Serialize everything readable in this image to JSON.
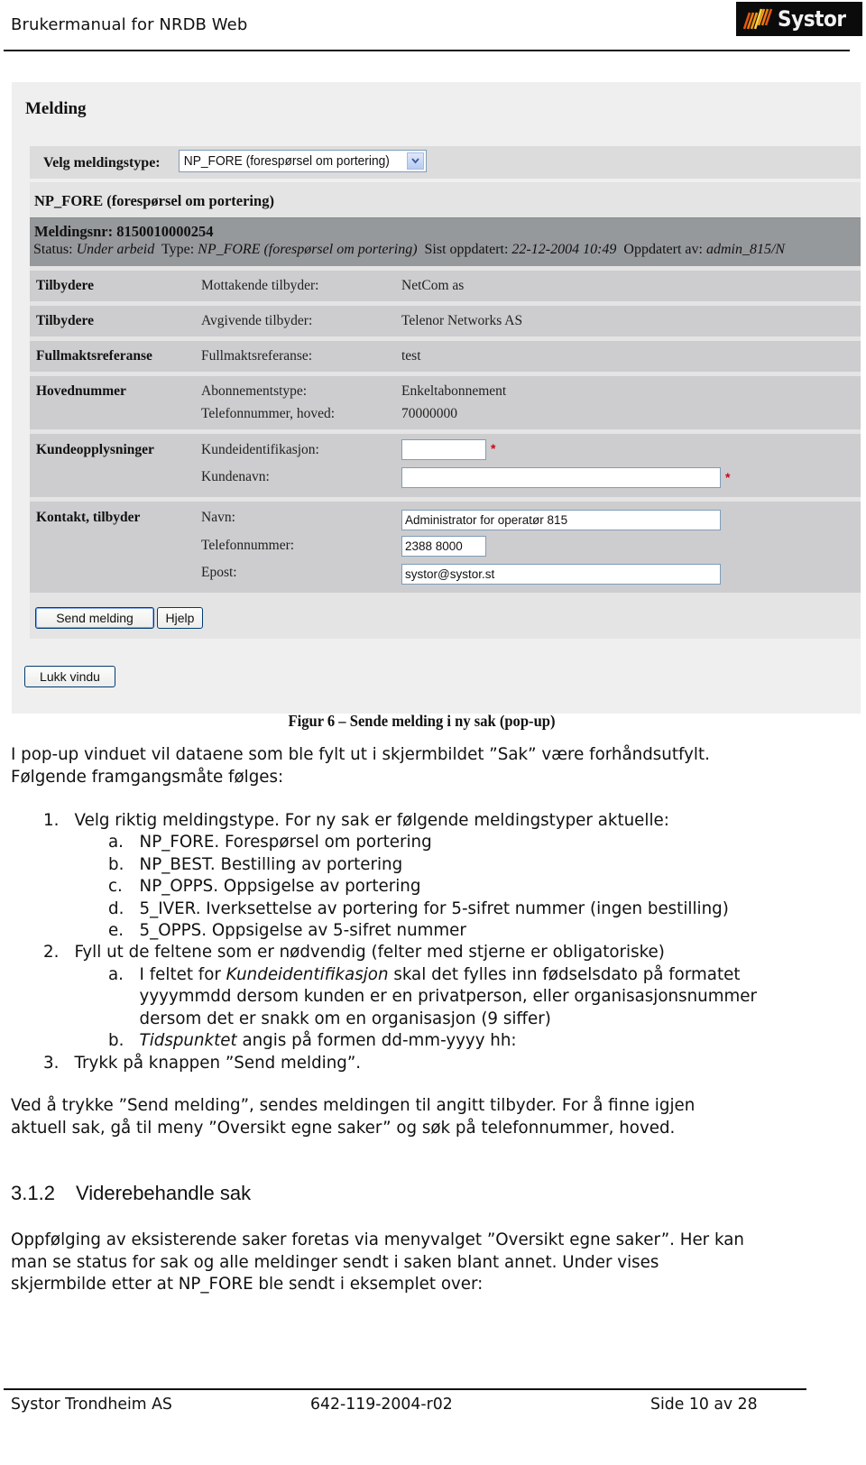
{
  "header": {
    "title": "Brukermanual for NRDB Web",
    "logo_text": "Systor",
    "logo_icon": "systor-stripes-logo"
  },
  "screenshot": {
    "title": "Melding",
    "type_label": "Velg meldingstype:",
    "type_selected": "NP_FORE (forespørsel om portering)",
    "panel_title": "NP_FORE (forespørsel om portering)",
    "meta": {
      "meldingsnr_label": "Meldingsnr:",
      "meldingsnr": "8150010000254",
      "status_label": "Status:",
      "status": "Under arbeid",
      "type_label": "Type:",
      "type": "NP_FORE (forespørsel om portering)",
      "updated_label": "Sist oppdatert:",
      "updated": "22-12-2004 10:49",
      "updated_by_label": "Oppdatert av:",
      "updated_by": "admin_815/N"
    },
    "rows": [
      {
        "section": "Tilbydere",
        "label": "Mottakende tilbyder:",
        "value": "NetCom as"
      },
      {
        "section": "Tilbydere",
        "label": "Avgivende tilbyder:",
        "value": "Telenor Networks AS"
      },
      {
        "section": "Fullmaktsreferanse",
        "label": "Fullmaktsreferanse:",
        "value": "test"
      },
      {
        "section": "Hovednummer",
        "label": "Abonnementstype:",
        "value": "Enkeltabonnement",
        "label2": "Telefonnummer, hoved:",
        "value2": "70000000"
      }
    ],
    "customer": {
      "section": "Kundeopplysninger",
      "id_label": "Kundeidentifikasjon:",
      "id_value": "",
      "name_label": "Kundenavn:",
      "name_value": "",
      "required_mark": "*"
    },
    "contact": {
      "section": "Kontakt, tilbyder",
      "name_label": "Navn:",
      "name_value": "Administrator for operatør 815",
      "phone_label": "Telefonnummer:",
      "phone_value": "2388 8000",
      "email_label": "Epost:",
      "email_value": "systor@systor.st"
    },
    "buttons": {
      "send": "Send melding",
      "help": "Hjelp",
      "close": "Lukk vindu"
    }
  },
  "caption": "Figur 6 – Sende melding i ny sak (pop-up)",
  "intro": [
    "I pop-up vinduet vil dataene som ble fylt ut i skjermbildet ”Sak” være forhåndsutfylt.",
    "Følgende framgangsmåte følges:"
  ],
  "steps": [
    {
      "marker": "1.",
      "text": "Velg riktig meldingstype. For ny sak er følgende meldingstyper aktuelle:",
      "sub": [
        {
          "marker": "a.",
          "text": "NP_FORE. Forespørsel om portering"
        },
        {
          "marker": "b.",
          "text": "NP_BEST. Bestilling av portering"
        },
        {
          "marker": "c.",
          "text": "NP_OPPS. Oppsigelse av portering"
        },
        {
          "marker": "d.",
          "text": "5_IVER. Iverksettelse av portering for 5-sifret nummer (ingen bestilling)"
        },
        {
          "marker": "e.",
          "text": "5_OPPS. Oppsigelse av 5-sifret nummer"
        }
      ]
    },
    {
      "marker": "2.",
      "text": "Fyll ut de feltene som er nødvendig (felter med stjerne er obligatoriske)",
      "sub": [
        {
          "marker": "a.",
          "text_prefix": "I feltet for ",
          "text_em": "Kundeidentifikasjon",
          "text_suffix": " skal det fylles inn fødselsdato på formatet",
          "line2": "yyyymmdd dersom kunden er en privatperson, eller organisasjonsnummer",
          "line3": "dersom det er snakk om en organisasjon (9 siffer)"
        },
        {
          "marker": "b.",
          "text_em": "Tidspunktet",
          "text_suffix": " angis på formen dd-mm-yyyy hh:"
        }
      ]
    },
    {
      "marker": "3.",
      "text": "Trykk på knappen ”Send melding”."
    }
  ],
  "after_steps": [
    "Ved å trykke ”Send melding”, sendes meldingen til angitt tilbyder. For å finne igjen",
    "aktuell sak, gå til meny ”Oversikt egne saker” og søk på telefonnummer, hoved."
  ],
  "section": {
    "number": "3.1.2",
    "title": "Viderebehandle sak",
    "paragraph": [
      "Oppfølging av eksisterende saker foretas via menyvalget ”Oversikt egne saker”. Her kan",
      "man se status for sak og alle meldinger sendt i saken blant annet. Under vises",
      "skjermbilde etter at NP_FORE ble sendt i eksemplet over:"
    ]
  },
  "footer": {
    "company": "Systor Trondheim AS",
    "doc_id": "642-119-2004-r02",
    "page": "Side 10 av 28"
  },
  "colors": {
    "panel_bg": "#e4e4e4",
    "row_bg": "#cdccce",
    "meta_bar": "#96999b",
    "required": "#d0021b",
    "input_border": "#7f9db9"
  }
}
